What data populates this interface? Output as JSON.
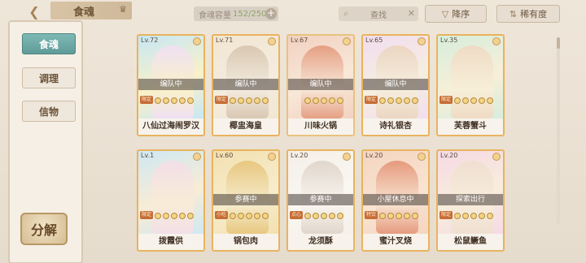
{
  "topbar": {
    "title": "食魂",
    "capacity_label": "食魂容量",
    "capacity_value": "152/250",
    "search_placeholder": "查找",
    "sort_desc_label": "降序",
    "sort_rarity_label": "稀有度"
  },
  "sidebar": {
    "items": [
      {
        "label": "食魂",
        "active": true
      },
      {
        "label": "调理",
        "active": false
      },
      {
        "label": "信物",
        "active": false
      }
    ],
    "decompose_label": "分解"
  },
  "cards": [
    {
      "level": "Lv.72",
      "status": "编队中",
      "badge": "限定",
      "name": "八仙过海闹罗汉",
      "palette": [
        "#c6e7f5",
        "#efe0f3",
        "#f9f1c9"
      ]
    },
    {
      "level": "Lv.71",
      "status": "编队中",
      "badge": "限定",
      "name": "椰盅海皇",
      "palette": [
        "#f2e6d2",
        "#d9c8b2",
        "#f4ecdf"
      ]
    },
    {
      "level": "Lv.67",
      "status": "编队中",
      "badge": "",
      "name": "川味火锅",
      "palette": [
        "#f2d1c0",
        "#e59f83",
        "#f8e8d8"
      ]
    },
    {
      "level": "Lv.65",
      "status": "编队中",
      "badge": "限定",
      "name": "诗礼银杏",
      "palette": [
        "#f1ddf0",
        "#ebd6c2",
        "#f6eee0"
      ]
    },
    {
      "level": "Lv.35",
      "status": "",
      "badge": "限定",
      "name": "芙蓉蟹斗",
      "palette": [
        "#d5eedc",
        "#efdbc5",
        "#f7efd8"
      ]
    },
    {
      "level": "Lv.1",
      "status": "",
      "badge": "限定",
      "name": "拨霞供",
      "palette": [
        "#cfe8f3",
        "#f2dfe8",
        "#f8ecd6"
      ]
    },
    {
      "level": "Lv.60",
      "status": "参赛中",
      "badge": "小吃",
      "name": "锅包肉",
      "palette": [
        "#f3e0b0",
        "#e8c780",
        "#f6eccc"
      ]
    },
    {
      "level": "Lv.20",
      "status": "参赛中",
      "badge": "点心",
      "name": "龙须酥",
      "palette": [
        "#f4efe9",
        "#e0d6cc",
        "#faf6f0"
      ]
    },
    {
      "level": "Lv.20",
      "status": "小屋休息中",
      "badge": "特饮",
      "name": "蜜汁叉烧",
      "palette": [
        "#f4d5c1",
        "#e69a7e",
        "#f8e4d1"
      ]
    },
    {
      "level": "Lv.20",
      "status": "探索出行",
      "badge": "限定",
      "name": "松鼠鳜鱼",
      "palette": [
        "#f6d9e5",
        "#efdfd0",
        "#f8eddc"
      ]
    }
  ],
  "colors": {
    "accent_teal": "#5f9b98",
    "frame_gold": "#e8c27e",
    "text_brown": "#6a5238"
  }
}
